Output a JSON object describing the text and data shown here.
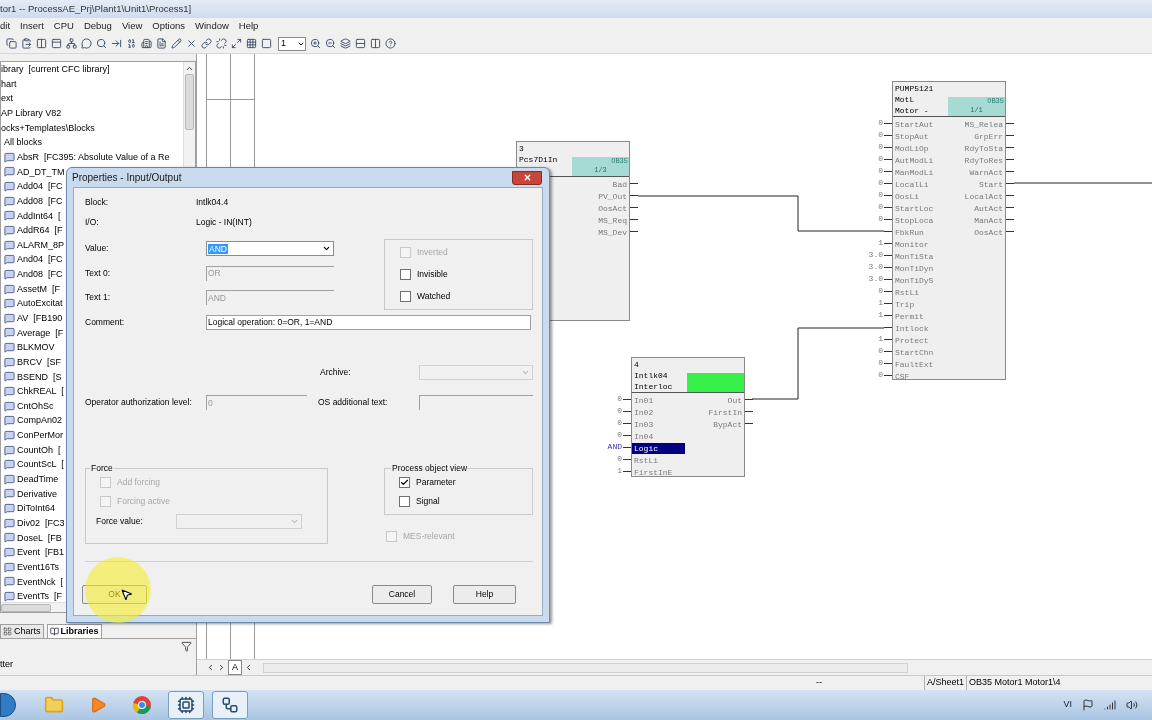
{
  "window": {
    "title": "tor1 -- ProcessAE_Prj\\Plant1\\Unit1\\Process1]"
  },
  "menu": [
    "dit",
    "Insert",
    "CPU",
    "Debug",
    "View",
    "Options",
    "Window",
    "Help"
  ],
  "toolbar": {
    "page_select": "1"
  },
  "library_tree": {
    "rows": [
      {
        "label": "ibrary  [current CFC library]"
      },
      {
        "label": "hart"
      },
      {
        "label": "ext"
      },
      {
        "label": "AP Library V82"
      },
      {
        "label": "ocks+Templates\\Blocks"
      },
      {
        "label": "All blocks",
        "children": [
          {
            "label": "AbsR  [FC395: Absolute Value of a Re"
          },
          {
            "label": "AD_DT_TM"
          },
          {
            "label": "Add04  [FC"
          },
          {
            "label": "Add08  [FC"
          },
          {
            "label": "AddInt64  ["
          },
          {
            "label": "AddR64  [F"
          },
          {
            "label": "ALARM_8P"
          },
          {
            "label": "And04  [FC"
          },
          {
            "label": "And08  [FC"
          },
          {
            "label": "AssetM  [F"
          },
          {
            "label": "AutoExcitat"
          },
          {
            "label": "AV  [FB190"
          },
          {
            "label": "Average  [F"
          },
          {
            "label": "BLKMOV"
          },
          {
            "label": "BRCV  [SF"
          },
          {
            "label": "BSEND  [S"
          },
          {
            "label": "ChkREAL  ["
          },
          {
            "label": "CntOhSc"
          },
          {
            "label": "CompAn02"
          },
          {
            "label": "ConPerMor"
          },
          {
            "label": "CountOh  ["
          },
          {
            "label": "CountScL  ["
          },
          {
            "label": "DeadTime"
          },
          {
            "label": "Derivative"
          },
          {
            "label": "DiToInt64"
          },
          {
            "label": "Div02  [FC3"
          },
          {
            "label": "DoseL  [FB"
          },
          {
            "label": "Event  [FB1"
          },
          {
            "label": "Event16Ts"
          },
          {
            "label": "EventNck  ["
          },
          {
            "label": "EventTs  [F"
          }
        ]
      }
    ]
  },
  "panel_tabs": [
    {
      "label": "Charts",
      "selected": false
    },
    {
      "label": "Libraries",
      "selected": true
    }
  ],
  "panel_footer": "tter",
  "blocks": [
    {
      "header": [
        "3",
        "Pcs7DiIn"
      ],
      "selected": false,
      "run_box": {
        "ob": "OB35",
        "seq": "1/3"
      },
      "outputs": [
        {
          "name": "Bad",
          "selected": false
        },
        {
          "name": "PV_Out",
          "selected": false
        },
        {
          "name": "OosAct",
          "selected": false
        },
        {
          "name": "MS_Req",
          "selected": false
        },
        {
          "name": "MS_Dev",
          "selected": false
        }
      ]
    },
    {
      "header": [
        "4",
        "Intlk04",
        "Interloc"
      ],
      "selected": true,
      "inputs": [
        {
          "name": "In01",
          "value": "0",
          "selected": false
        },
        {
          "name": "In02",
          "value": "0",
          "selected": false
        },
        {
          "name": "In03",
          "value": "0",
          "selected": false
        },
        {
          "name": "In04",
          "value": "0",
          "selected": false
        },
        {
          "name": "Logic",
          "value": "AND",
          "selected": true
        },
        {
          "name": "RstLi",
          "value": "0",
          "selected": false
        },
        {
          "name": "FirstInE",
          "value": "1",
          "selected": false
        }
      ],
      "outputs": [
        {
          "name": "Out",
          "selected": false
        },
        {
          "name": "FirstIn",
          "selected": false
        },
        {
          "name": "BypAct",
          "selected": false
        }
      ]
    },
    {
      "header": [
        "PUMP5121",
        "MotL",
        "Motor -"
      ],
      "selected": false,
      "run_box": {
        "ob": "OB35",
        "seq": "1/1"
      },
      "inputs": [
        {
          "name": "StartAut",
          "value": "0",
          "selected": false
        },
        {
          "name": "StopAut",
          "value": "0",
          "selected": false
        },
        {
          "name": "ModLiOp",
          "value": "0",
          "selected": false
        },
        {
          "name": "AutModLi",
          "value": "0",
          "selected": false
        },
        {
          "name": "ManModLi",
          "value": "0",
          "selected": false
        },
        {
          "name": "LocalLi",
          "value": "0",
          "selected": false
        },
        {
          "name": "OosLi",
          "value": "0",
          "selected": false
        },
        {
          "name": "StartLoc",
          "value": "0",
          "selected": false
        },
        {
          "name": "StopLoca",
          "value": "0",
          "selected": false
        },
        {
          "name": "FbkRun",
          "selected": false
        },
        {
          "name": "Monitor",
          "value": "1",
          "selected": false
        },
        {
          "name": "MonTiSta",
          "value": "3.0",
          "selected": false
        },
        {
          "name": "MonTiDyn",
          "value": "3.0",
          "selected": false
        },
        {
          "name": "MonTiDyS",
          "value": "3.0",
          "selected": false
        },
        {
          "name": "RstLi",
          "value": "0",
          "selected": false
        },
        {
          "name": "Trip",
          "value": "1",
          "selected": false
        },
        {
          "name": "Permit",
          "value": "1",
          "selected": false
        },
        {
          "name": "Intlock",
          "selected": false
        },
        {
          "name": "Protect",
          "value": "1",
          "selected": false
        },
        {
          "name": "StartChn",
          "value": "0",
          "selected": false
        },
        {
          "name": "FaultExt",
          "value": "0",
          "selected": false
        },
        {
          "name": "CSF",
          "value": "0",
          "selected": false
        }
      ],
      "outputs": [
        {
          "name": "MS_Relea",
          "selected": false
        },
        {
          "name": "GrpErr",
          "selected": false
        },
        {
          "name": "RdyToSta",
          "selected": false
        },
        {
          "name": "RdyToRes",
          "selected": false
        },
        {
          "name": "WarnAct",
          "selected": false
        },
        {
          "name": "Start",
          "selected": false
        },
        {
          "name": "LocalAct",
          "selected": false
        },
        {
          "name": "AutAct",
          "selected": false
        },
        {
          "name": "ManAct",
          "selected": false
        },
        {
          "name": "OosAct",
          "selected": false
        }
      ]
    }
  ],
  "sheet_tab": "A",
  "dialog": {
    "title": "Properties - Input/Output",
    "info": [
      {
        "label": "Block:",
        "value": "Intlk04.4"
      },
      {
        "label": "I/O:",
        "value": "Logic - IN(INT)"
      }
    ],
    "fields": [
      {
        "kind": "combo",
        "label": "Value:",
        "value": "AND",
        "disabled": false,
        "text_selected": true
      },
      {
        "kind": "text",
        "label": "Text 0:",
        "value": "OR",
        "disabled": true,
        "text_selected": false
      },
      {
        "kind": "text",
        "label": "Text 1:",
        "value": "AND",
        "disabled": true,
        "text_selected": false
      }
    ],
    "flags": [
      {
        "label": "Inverted",
        "checked": false,
        "disabled": true
      },
      {
        "label": "Invisible",
        "checked": false,
        "disabled": false
      },
      {
        "label": "Watched",
        "checked": false,
        "disabled": false
      }
    ],
    "comment": {
      "label": "Comment:",
      "value": "Logical operation: 0=OR, 1=AND"
    },
    "archive": {
      "label": "Archive:",
      "disabled": true
    },
    "operator_level": {
      "label": "Operator authorization level:",
      "value": "0",
      "disabled": true
    },
    "os_text": {
      "label": "OS additional text:",
      "disabled": true
    },
    "force": {
      "title": "Force",
      "options": [
        {
          "label": "Add forcing",
          "checked": false,
          "disabled": true
        },
        {
          "label": "Forcing active",
          "checked": false,
          "disabled": true
        }
      ],
      "force_value": {
        "label": "Force value:",
        "disabled": true
      }
    },
    "process_object_view": {
      "title": "Process object view",
      "options": [
        {
          "label": "Parameter",
          "checked": true,
          "disabled": false
        },
        {
          "label": "Signal",
          "checked": false,
          "disabled": false
        }
      ]
    },
    "mes_relevant": {
      "label": "MES-relevant",
      "checked": false,
      "disabled": true
    },
    "buttons": [
      {
        "label": "OK"
      },
      {
        "label": "Cancel"
      },
      {
        "label": "Help"
      }
    ]
  },
  "status_bar": [
    "--",
    "A/Sheet1",
    "OB35 Motor1 Motor1\\4"
  ],
  "taskbar": {
    "apps": [
      {
        "kind": "folder",
        "active": false
      },
      {
        "kind": "media",
        "active": false
      },
      {
        "kind": "browser",
        "active": false
      },
      {
        "kind": "simatic",
        "active": true
      },
      {
        "kind": "cfc",
        "active": true
      }
    ],
    "language": "VI"
  }
}
